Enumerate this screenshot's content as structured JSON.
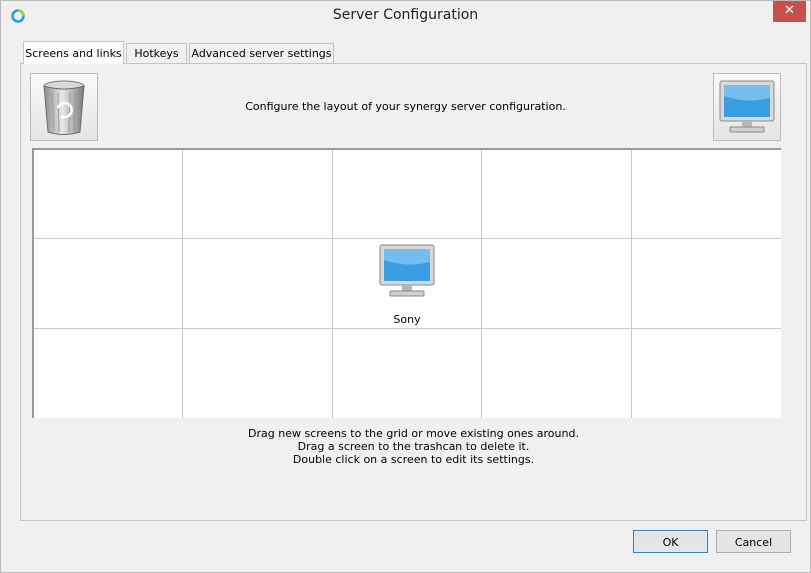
{
  "window": {
    "title": "Server Configuration",
    "close_label": "✕"
  },
  "tabs": [
    {
      "label": "Screens and links",
      "active": true
    },
    {
      "label": "Hotkeys",
      "active": false
    },
    {
      "label": "Advanced server settings",
      "active": false
    }
  ],
  "toolbar": {
    "trash_icon": "trash-can-icon",
    "new_screen_icon": "monitor-icon",
    "instruction": "Configure the layout of your synergy server configuration."
  },
  "grid": {
    "rows": 3,
    "columns": 5,
    "screens": [
      {
        "name": "Sony",
        "row": 2,
        "column": 3,
        "icon": "monitor-icon"
      }
    ]
  },
  "help": {
    "line1": "Drag new screens to the grid or move existing ones around.",
    "line2": "Drag a screen to the trashcan to delete it.",
    "line3": "Double click on a screen to edit its settings."
  },
  "buttons": {
    "ok_label": "OK",
    "cancel_label": "Cancel"
  },
  "colors": {
    "close_button": "#c7504c",
    "monitor_screen": "#3a9ee3"
  }
}
